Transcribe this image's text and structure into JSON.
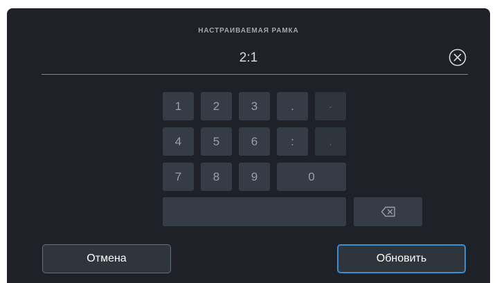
{
  "dialog": {
    "title": "НАСТРАИВАЕМАЯ РАМКА",
    "value": "2:1"
  },
  "keypad": {
    "keys": {
      "k1": "1",
      "k2": "2",
      "k3": "3",
      "dot": ".",
      "dash": "-",
      "k4": "4",
      "k5": "5",
      "k6": "6",
      "colon": ":",
      "comma": ",",
      "k7": "7",
      "k8": "8",
      "k9": "9",
      "k0": "0",
      "space": ""
    }
  },
  "buttons": {
    "cancel": "Отмена",
    "update": "Обновить"
  },
  "icons": {
    "clear": "close-circle-icon",
    "backspace": "backspace-icon"
  },
  "colors": {
    "panel": "#1e2228",
    "key": "#363c45",
    "accent": "#3a8fd1"
  }
}
